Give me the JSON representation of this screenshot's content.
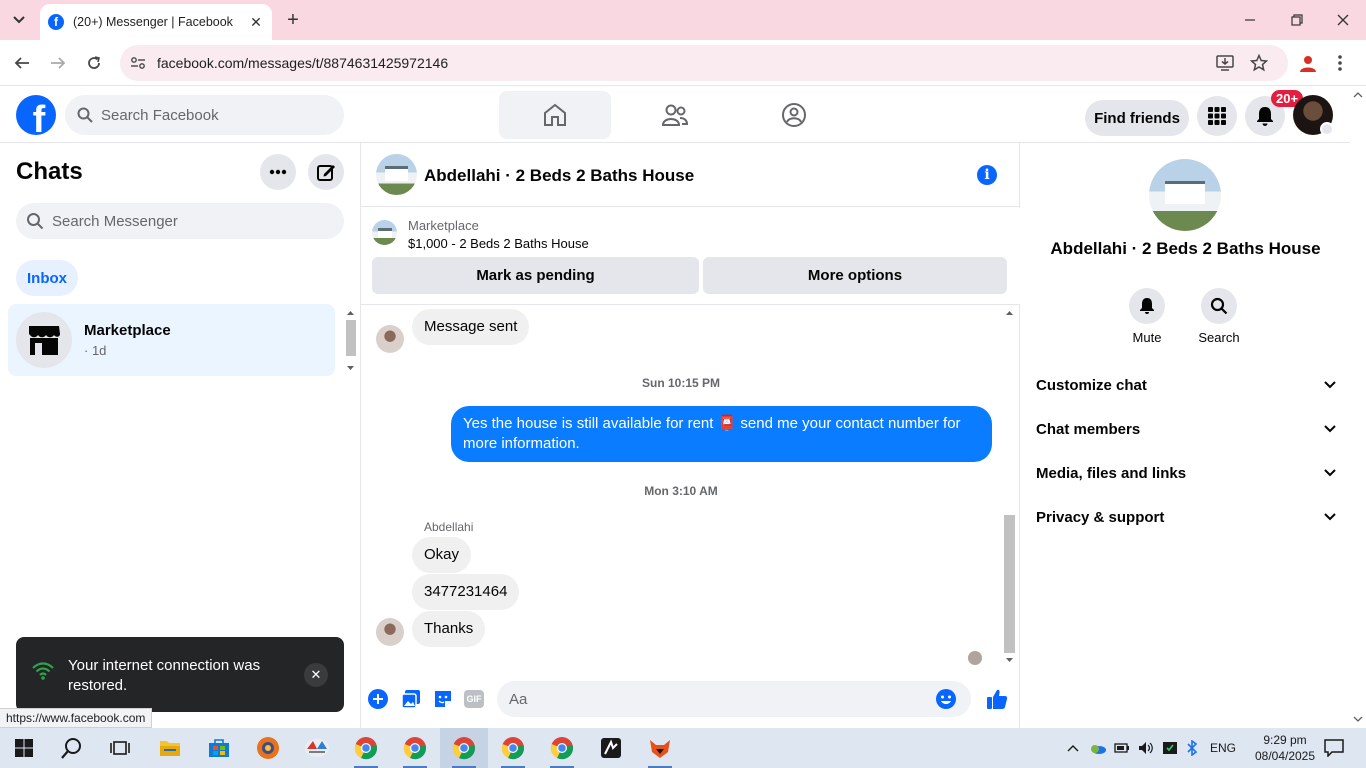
{
  "browser": {
    "tab_title": "(20+) Messenger | Facebook",
    "url": "facebook.com/messages/t/8874631425972146",
    "status_url": "https://www.facebook.com"
  },
  "fb": {
    "search_placeholder": "Search Facebook",
    "find_friends": "Find friends",
    "notif_badge": "20+"
  },
  "chats": {
    "title": "Chats",
    "search_placeholder": "Search Messenger",
    "inbox": "Inbox",
    "items": [
      {
        "name": "Marketplace",
        "meta": "· 1d"
      }
    ]
  },
  "toast": {
    "text": "Your internet connection was restored."
  },
  "conversation": {
    "name": "Abdellahi · 2 Beds 2 Baths House",
    "marketplace_label": "Marketplace",
    "marketplace_item": "$1,000 - 2 Beds 2 Baths House",
    "mark_pending": "Mark as pending",
    "more_options": "More options",
    "messages": {
      "msg_sent": "Message sent",
      "ts1": "Sun 10:15 PM",
      "mine": "Yes the house is still available for rent 📮 send me your contact number for more information.",
      "ts2": "Mon 3:10 AM",
      "sender": "Abdellahi",
      "r1": "Okay",
      "r2": "3477231464",
      "r3": "Thanks"
    },
    "composer_placeholder": "Aa",
    "gif": "GIF"
  },
  "right_panel": {
    "name": "Abdellahi · 2 Beds 2 Baths House",
    "mute": "Mute",
    "search": "Search",
    "sections": [
      "Customize chat",
      "Chat members",
      "Media, files and links",
      "Privacy & support"
    ]
  },
  "taskbar": {
    "lang": "ENG",
    "time": "9:29 pm",
    "date": "08/04/2025"
  },
  "colors": {
    "accent": "#0866ff",
    "my_bubble": "#0a7cff",
    "tab_strip": "#f9d8e2"
  }
}
